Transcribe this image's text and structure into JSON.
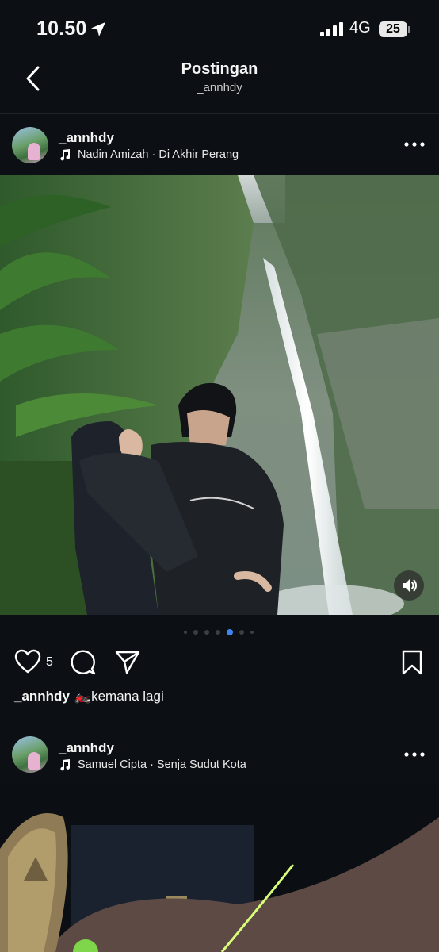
{
  "status_bar": {
    "time": "10.50",
    "network": "4G",
    "battery": "25"
  },
  "header": {
    "title": "Postingan",
    "subtitle": "_annhdy"
  },
  "posts": [
    {
      "username": "_annhdy",
      "music": "Nadin Amizah · Di Akhir Perang",
      "likes": "5",
      "caption_user": "_annhdy",
      "caption_text": "🏍️kemana lagi",
      "carousel": {
        "total": 7,
        "active_index": 4
      }
    },
    {
      "username": "_annhdy",
      "music": "Samuel Cipta · Senja Sudut Kota"
    }
  ],
  "icons": {
    "location": "location-arrow-icon",
    "signal": "cellular-signal-icon",
    "back": "chevron-left-icon",
    "more": "more-horizontal-icon",
    "music": "music-note-icon",
    "mute": "speaker-icon",
    "like": "heart-icon",
    "comment": "comment-icon",
    "share": "send-icon",
    "save": "bookmark-icon"
  },
  "colors": {
    "background": "#0c1014",
    "active_dot": "#3f86f2"
  }
}
